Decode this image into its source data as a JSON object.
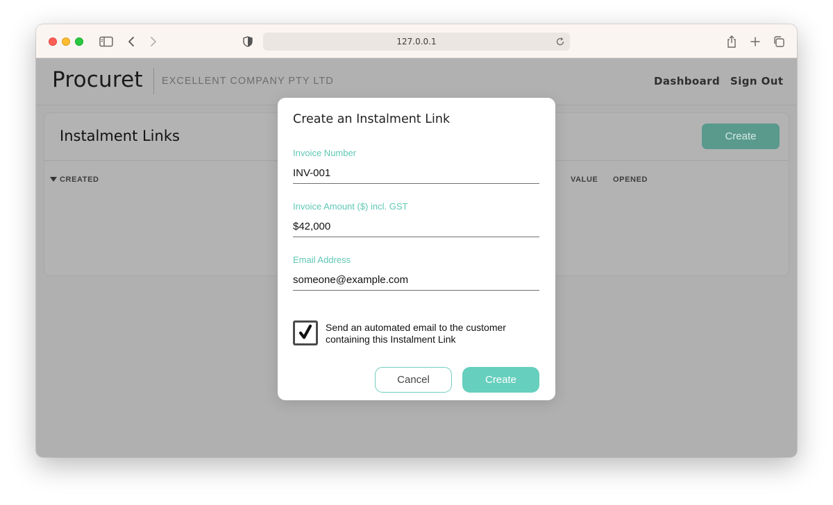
{
  "browser": {
    "url": "127.0.0.1"
  },
  "header": {
    "logo": "Procuret",
    "company": "EXCELLENT COMPANY PTY LTD",
    "nav": {
      "dashboard": "Dashboard",
      "sign_out": "Sign Out"
    }
  },
  "card": {
    "title": "Instalment Links",
    "create_label": "Create",
    "columns": {
      "created": "CREATED",
      "value": "VALUE",
      "opened": "OPENED"
    }
  },
  "modal": {
    "title": "Create an Instalment Link",
    "fields": {
      "invoice_number": {
        "label": "Invoice Number",
        "value": "INV-001"
      },
      "invoice_amount": {
        "label": "Invoice Amount ($) incl. GST",
        "value": "$42,000"
      },
      "email": {
        "label": "Email Address",
        "value": "someone@example.com"
      }
    },
    "send_email": {
      "checked": true,
      "line1": "Send an automated email to the customer",
      "line2": "containing this Instalment Link"
    },
    "cancel_label": "Cancel",
    "create_label": "Create"
  },
  "colors": {
    "accent": "#66cfbd",
    "label": "#5fc7b4",
    "dimmed_accent": "#5a9a8d"
  }
}
